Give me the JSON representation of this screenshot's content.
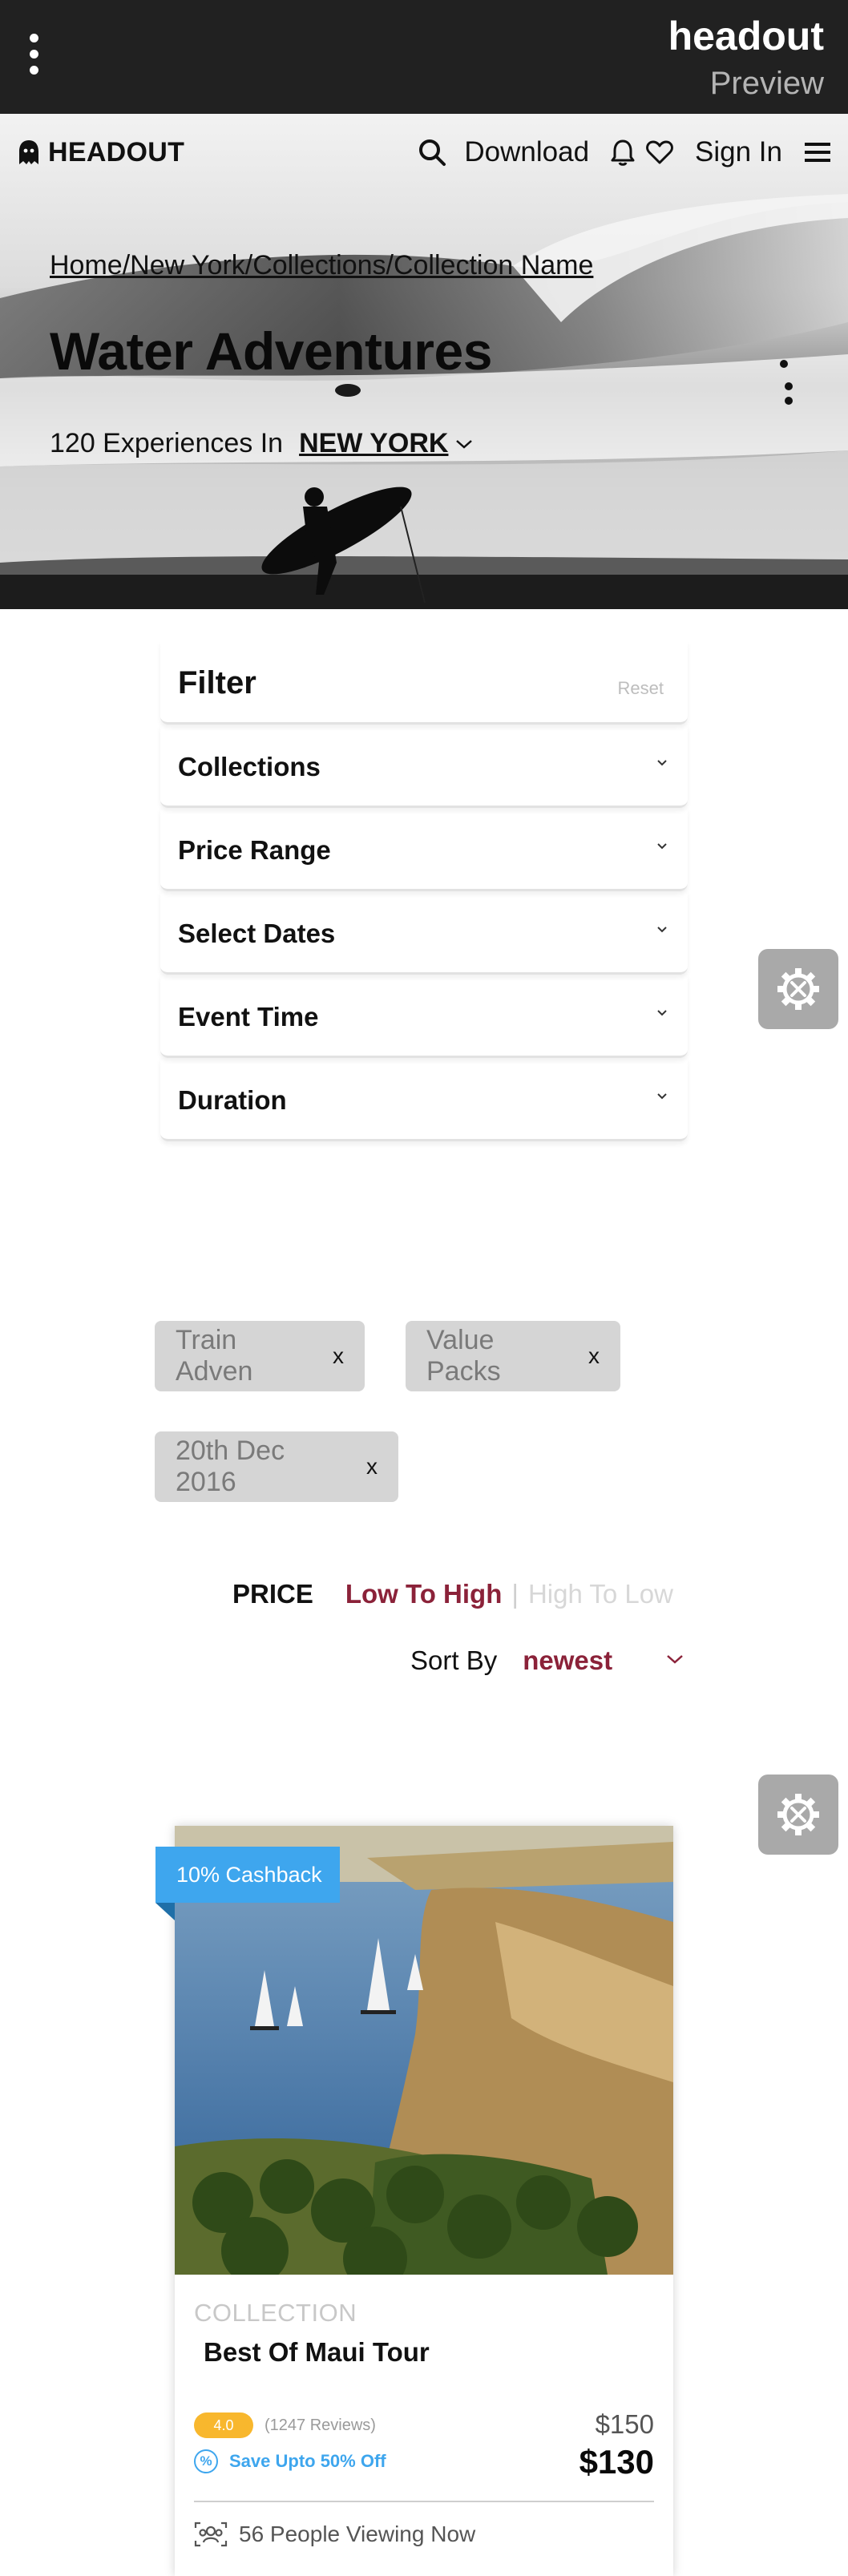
{
  "preview": {
    "brand": "headout",
    "sub": "Preview"
  },
  "nav": {
    "logo": "HEADOUT",
    "download": "Download",
    "signin": "Sign In"
  },
  "hero": {
    "breadcrumb": "Home/New York/Collections/Collection Name",
    "title": "Water Adventures",
    "experiences": "120 Experiences In",
    "city": "NEW YORK"
  },
  "filter": {
    "title": "Filter",
    "reset": "Reset",
    "items": [
      "Collections",
      "Price Range",
      "Select Dates",
      "Event Time",
      "Duration"
    ]
  },
  "chips": [
    {
      "label": "Train Adven",
      "x": "x"
    },
    {
      "label": "Value Packs",
      "x": "x"
    },
    {
      "label": "20th Dec 2016",
      "x": "x"
    }
  ],
  "sort": {
    "price_label": "PRICE",
    "low_high": "Low To High",
    "separator": "|",
    "high_low": "High To Low",
    "sort_by": "Sort By",
    "sort_value": "newest"
  },
  "card": {
    "ribbon": "10% Cashback",
    "type": "COLLECTION",
    "name": "Best Of Maui Tour",
    "rating": "4.0",
    "reviews": "(1247 Reviews)",
    "save": "Save Upto 50% Off",
    "old_price": "$150",
    "new_price": "$130",
    "viewers": "56 People Viewing Now"
  },
  "colors": {
    "accent": "#8b2239",
    "blue": "#3ea6ee",
    "rating": "#f8b72d",
    "preview_bar": "#212121"
  },
  "icons": [
    "kebab-menu-icon",
    "ghost-logo-icon",
    "search-icon",
    "bell-icon",
    "heart-icon",
    "hamburger-icon",
    "chevron-down-icon",
    "gear-icon",
    "percent-icon",
    "people-icon"
  ]
}
